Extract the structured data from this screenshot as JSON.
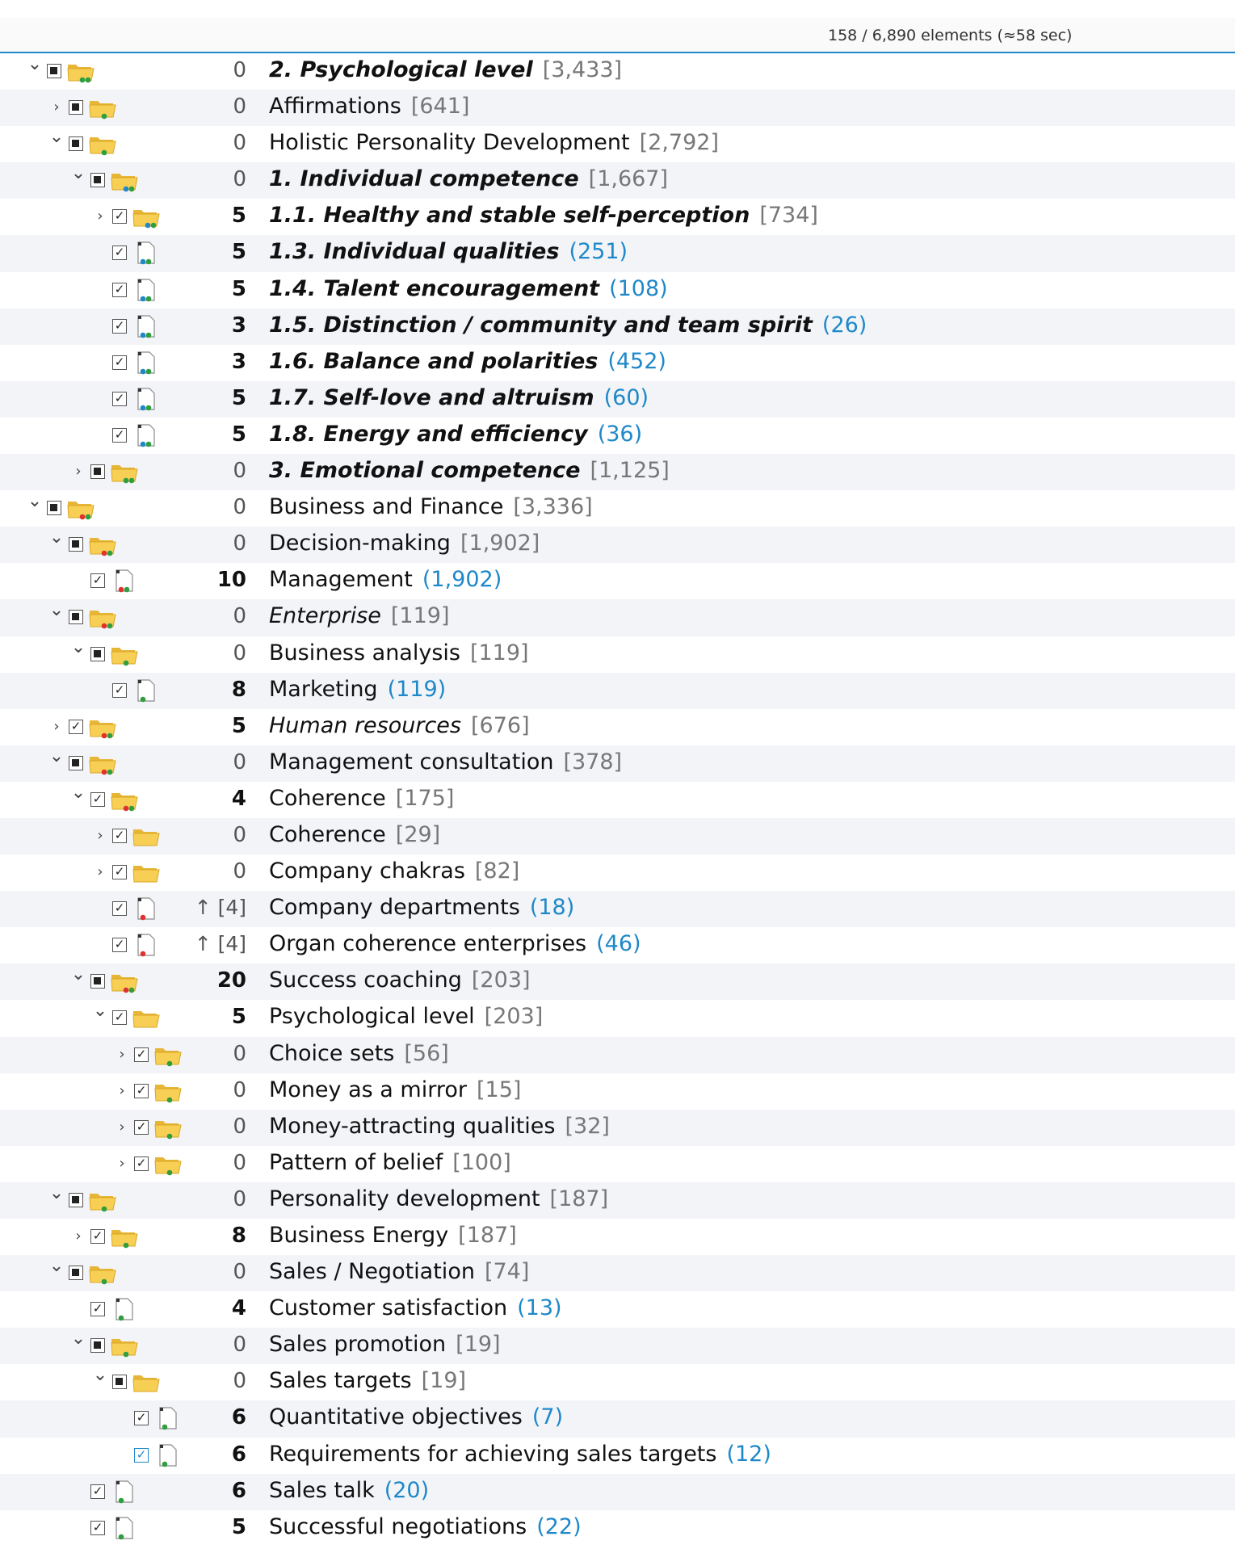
{
  "status": {
    "text": "158 / 6,890 elements (≈58 sec)"
  },
  "rows": [
    {
      "level": 0,
      "exp": "open",
      "chk": "partial",
      "icon": "folder",
      "dots": [
        "#2e9e3f",
        "#2e9e3f"
      ],
      "num": "0",
      "label": "2. Psychological level",
      "count": "[3,433]",
      "style": "italic"
    },
    {
      "level": 1,
      "exp": "closed",
      "chk": "partial",
      "icon": "folder",
      "dots": [
        "#2e9e3f"
      ],
      "num": "0",
      "label": "Affirmations",
      "count": "[641]",
      "style": "normal"
    },
    {
      "level": 1,
      "exp": "open",
      "chk": "partial",
      "icon": "folder",
      "dots": [
        "#2e9e3f"
      ],
      "num": "0",
      "label": "Holistic Personality Development",
      "count": "[2,792]",
      "style": "normal"
    },
    {
      "level": 2,
      "exp": "open",
      "chk": "partial",
      "icon": "folder",
      "dots": [
        "#1e88c9",
        "#2e9e3f"
      ],
      "num": "0",
      "label": "1. Individual competence",
      "count": "[1,667]",
      "style": "italic"
    },
    {
      "level": 3,
      "exp": "closed",
      "chk": "checked",
      "icon": "folder",
      "dots": [
        "#1e88c9",
        "#2e9e3f"
      ],
      "num": "5",
      "label": "1.1. Healthy and stable self-perception",
      "count": "[734]",
      "style": "italic"
    },
    {
      "level": 3,
      "exp": "none",
      "chk": "checked",
      "icon": "doc",
      "dots": [
        "#1e88c9",
        "#2e9e3f"
      ],
      "num": "5",
      "label": "1.3. Individual qualities",
      "count": "(251)",
      "style": "italic"
    },
    {
      "level": 3,
      "exp": "none",
      "chk": "checked",
      "icon": "doc",
      "dots": [
        "#1e88c9",
        "#2e9e3f"
      ],
      "num": "5",
      "label": "1.4. Talent encouragement",
      "count": "(108)",
      "style": "italic"
    },
    {
      "level": 3,
      "exp": "none",
      "chk": "checked",
      "icon": "doc",
      "dots": [
        "#1e88c9",
        "#2e9e3f"
      ],
      "num": "3",
      "label": "1.5. Distinction / community and team spirit",
      "count": "(26)",
      "style": "italic"
    },
    {
      "level": 3,
      "exp": "none",
      "chk": "checked",
      "icon": "doc",
      "dots": [
        "#1e88c9",
        "#2e9e3f"
      ],
      "num": "3",
      "label": "1.6. Balance and polarities",
      "count": "(452)",
      "style": "italic"
    },
    {
      "level": 3,
      "exp": "none",
      "chk": "checked",
      "icon": "doc",
      "dots": [
        "#1e88c9",
        "#2e9e3f"
      ],
      "num": "5",
      "label": "1.7. Self-love and altruism",
      "count": "(60)",
      "style": "italic"
    },
    {
      "level": 3,
      "exp": "none",
      "chk": "checked",
      "icon": "doc",
      "dots": [
        "#1e88c9",
        "#2e9e3f"
      ],
      "num": "5",
      "label": "1.8. Energy and efficiency",
      "count": "(36)",
      "style": "italic"
    },
    {
      "level": 2,
      "exp": "closed",
      "chk": "partial",
      "icon": "folder",
      "dots": [
        "#2e9e3f",
        "#2e9e3f"
      ],
      "num": "0",
      "label": "3. Emotional competence",
      "count": "[1,125]",
      "style": "italic"
    },
    {
      "level": 0,
      "exp": "open",
      "chk": "partial",
      "icon": "folder",
      "dots": [
        "#e03030",
        "#2e9e3f"
      ],
      "num": "0",
      "label": "Business and Finance",
      "count": "[3,336]",
      "style": "normal"
    },
    {
      "level": 1,
      "exp": "open",
      "chk": "partial",
      "icon": "folder",
      "dots": [
        "#e03030",
        "#2e9e3f"
      ],
      "num": "0",
      "label": "Decision-making",
      "count": "[1,902]",
      "style": "normal"
    },
    {
      "level": 2,
      "exp": "none",
      "chk": "checked",
      "icon": "doc",
      "dots": [
        "#e03030",
        "#2e9e3f"
      ],
      "num": "10",
      "label": "Management",
      "count": "(1,902)",
      "style": "normal"
    },
    {
      "level": 1,
      "exp": "open",
      "chk": "partial",
      "icon": "folder",
      "dots": [
        "#e03030",
        "#2e9e3f"
      ],
      "num": "0",
      "label": "Enterprise",
      "count": "[119]",
      "style": "italicplain"
    },
    {
      "level": 2,
      "exp": "open",
      "chk": "partial",
      "icon": "folder",
      "dots": [
        "#2e9e3f"
      ],
      "num": "0",
      "label": "Business analysis",
      "count": "[119]",
      "style": "normal"
    },
    {
      "level": 3,
      "exp": "none",
      "chk": "checked",
      "icon": "doc",
      "dots": [
        "#2e9e3f"
      ],
      "num": "8",
      "label": "Marketing",
      "count": "(119)",
      "style": "normal"
    },
    {
      "level": 1,
      "exp": "closed",
      "chk": "checked",
      "icon": "folder",
      "dots": [
        "#e03030",
        "#2e9e3f"
      ],
      "num": "5",
      "label": "Human resources",
      "count": "[676]",
      "style": "italicplain"
    },
    {
      "level": 1,
      "exp": "open",
      "chk": "partial",
      "icon": "folder",
      "dots": [
        "#e03030",
        "#2e9e3f"
      ],
      "num": "0",
      "label": "Management consultation",
      "count": "[378]",
      "style": "normal"
    },
    {
      "level": 2,
      "exp": "open",
      "chk": "checked",
      "icon": "folder",
      "dots": [
        "#e03030",
        "#2e9e3f"
      ],
      "num": "4",
      "label": "Coherence",
      "count": "[175]",
      "style": "normal"
    },
    {
      "level": 3,
      "exp": "closed",
      "chk": "checked",
      "icon": "folder",
      "dots": [],
      "num": "0",
      "label": "Coherence",
      "count": "[29]",
      "style": "normal"
    },
    {
      "level": 3,
      "exp": "closed",
      "chk": "checked",
      "icon": "folder",
      "dots": [],
      "num": "0",
      "label": "Company chakras",
      "count": "[82]",
      "style": "normal"
    },
    {
      "level": 3,
      "exp": "none",
      "chk": "checked",
      "icon": "doc",
      "dots": [
        "#e03030"
      ],
      "num": "↑ [4]",
      "label": "Company departments",
      "count": "(18)",
      "style": "normal"
    },
    {
      "level": 3,
      "exp": "none",
      "chk": "checked",
      "icon": "doc",
      "dots": [
        "#e03030"
      ],
      "num": "↑ [4]",
      "label": "Organ coherence enterprises",
      "count": "(46)",
      "style": "normal"
    },
    {
      "level": 2,
      "exp": "open",
      "chk": "partial",
      "icon": "folder",
      "dots": [
        "#e03030",
        "#2e9e3f"
      ],
      "num": "20",
      "label": "Success coaching",
      "count": "[203]",
      "style": "normal"
    },
    {
      "level": 3,
      "exp": "open",
      "chk": "checked",
      "icon": "folder",
      "dots": [],
      "num": "5",
      "label": "Psychological level",
      "count": "[203]",
      "style": "normal"
    },
    {
      "level": 4,
      "exp": "closed",
      "chk": "checked",
      "icon": "folder",
      "dots": [
        "#2e9e3f"
      ],
      "num": "0",
      "label": "Choice sets",
      "count": "[56]",
      "style": "normal"
    },
    {
      "level": 4,
      "exp": "closed",
      "chk": "checked",
      "icon": "folder",
      "dots": [
        "#2e9e3f"
      ],
      "num": "0",
      "label": "Money as a mirror",
      "count": "[15]",
      "style": "normal"
    },
    {
      "level": 4,
      "exp": "closed",
      "chk": "checked",
      "icon": "folder",
      "dots": [
        "#2e9e3f"
      ],
      "num": "0",
      "label": "Money-attracting qualities",
      "count": "[32]",
      "style": "normal"
    },
    {
      "level": 4,
      "exp": "closed",
      "chk": "checked",
      "icon": "folder",
      "dots": [
        "#2e9e3f"
      ],
      "num": "0",
      "label": "Pattern of belief",
      "count": "[100]",
      "style": "normal"
    },
    {
      "level": 1,
      "exp": "open",
      "chk": "partial",
      "icon": "folder",
      "dots": [
        "#2e9e3f"
      ],
      "num": "0",
      "label": "Personality development",
      "count": "[187]",
      "style": "normal"
    },
    {
      "level": 2,
      "exp": "closed",
      "chk": "checked",
      "icon": "folder",
      "dots": [
        "#2e9e3f"
      ],
      "num": "8",
      "label": "Business Energy",
      "count": "[187]",
      "style": "normal"
    },
    {
      "level": 1,
      "exp": "open",
      "chk": "partial",
      "icon": "folder",
      "dots": [
        "#2e9e3f"
      ],
      "num": "0",
      "label": "Sales / Negotiation",
      "count": "[74]",
      "style": "normal"
    },
    {
      "level": 2,
      "exp": "none",
      "chk": "checked",
      "icon": "doc",
      "dots": [
        "#2e9e3f"
      ],
      "num": "4",
      "label": "Customer satisfaction",
      "count": "(13)",
      "style": "normal"
    },
    {
      "level": 2,
      "exp": "open",
      "chk": "partial",
      "icon": "folder",
      "dots": [
        "#2e9e3f"
      ],
      "num": "0",
      "label": "Sales promotion",
      "count": "[19]",
      "style": "normal"
    },
    {
      "level": 3,
      "exp": "open",
      "chk": "partial",
      "icon": "folder",
      "dots": [],
      "num": "0",
      "label": "Sales targets",
      "count": "[19]",
      "style": "normal"
    },
    {
      "level": 4,
      "exp": "none",
      "chk": "checked",
      "icon": "doc",
      "dots": [
        "#2e9e3f"
      ],
      "num": "6",
      "label": "Quantitative objectives",
      "count": "(7)",
      "style": "normal"
    },
    {
      "level": 4,
      "exp": "none",
      "chk": "checked-blue",
      "icon": "doc",
      "dots": [
        "#2e9e3f"
      ],
      "num": "6",
      "label": "Requirements for achieving sales targets",
      "count": "(12)",
      "style": "normal"
    },
    {
      "level": 2,
      "exp": "none",
      "chk": "checked",
      "icon": "doc",
      "dots": [
        "#2e9e3f"
      ],
      "num": "6",
      "label": "Sales talk",
      "count": "(20)",
      "style": "normal"
    },
    {
      "level": 2,
      "exp": "none",
      "chk": "checked",
      "icon": "doc",
      "dots": [
        "#2e9e3f"
      ],
      "num": "5",
      "label": "Successful negotiations",
      "count": "(22)",
      "style": "normal"
    }
  ]
}
